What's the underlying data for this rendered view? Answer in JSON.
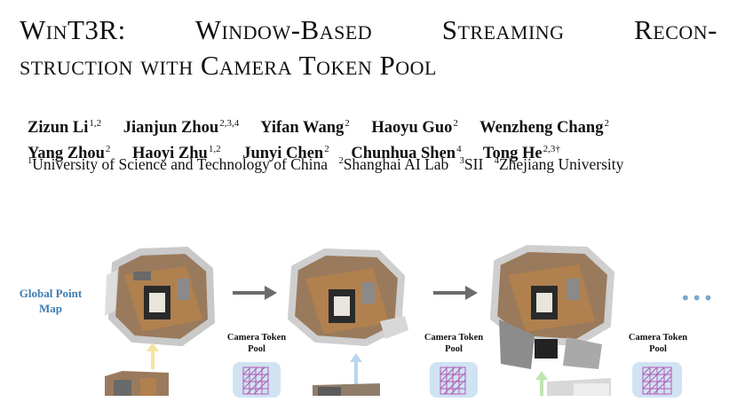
{
  "title": {
    "line1": "WinT3R: Window-Based Streaming Recon-",
    "line2": "struction with Camera Token Pool"
  },
  "authors_row1": [
    {
      "name": "Zizun Li",
      "sup": "1,2"
    },
    {
      "name": "Jianjun Zhou",
      "sup": "2,3,4"
    },
    {
      "name": "Yifan Wang",
      "sup": "2"
    },
    {
      "name": "Haoyu Guo",
      "sup": "2"
    },
    {
      "name": "Wenzheng Chang",
      "sup": "2"
    }
  ],
  "authors_row2": [
    {
      "name": "Yang Zhou",
      "sup": "2"
    },
    {
      "name": "Haoyi Zhu",
      "sup": "1,2"
    },
    {
      "name": "Junyi Chen",
      "sup": "2"
    },
    {
      "name": "Chunhua Shen",
      "sup": "4"
    },
    {
      "name": "Tong He",
      "sup": "2,3†"
    }
  ],
  "affiliations": [
    {
      "sup": "1",
      "name": "University of Science and Technology of China"
    },
    {
      "sup": "2",
      "name": "Shanghai AI Lab"
    },
    {
      "sup": "3",
      "name": "SII"
    },
    {
      "sup": "4",
      "name": "Zhejiang University"
    }
  ],
  "figure": {
    "global_point_map_label": "Global Point Map",
    "pool_labels": [
      "Camera Token Pool",
      "Camera Token Pool",
      "Camera Token Pool"
    ],
    "ellipsis": "•••",
    "colors": {
      "accent_blue": "#3e7db2",
      "arrow_gray": "#6b6b6b",
      "arrow_yellow": "#f5e3a0",
      "arrow_blue": "#b9d6ee",
      "arrow_green": "#bfe5b0",
      "pool_bg": "#cfe3f3",
      "pool_grid": "#b45ab4"
    }
  }
}
